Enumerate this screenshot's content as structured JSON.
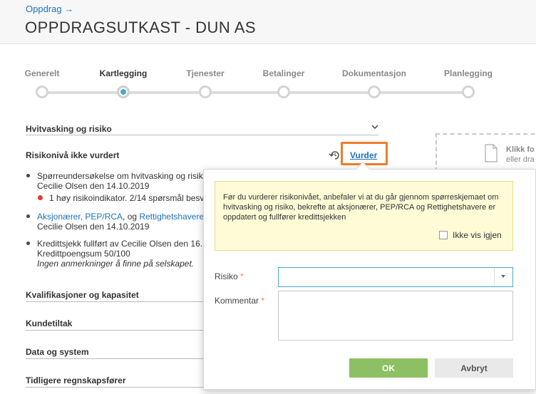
{
  "header": {
    "breadcrumb": "Oppdrag →",
    "title": "OPPDRAGSUTKAST - DUN AS"
  },
  "steps": [
    {
      "label": "Generelt",
      "active": false
    },
    {
      "label": "Kartlegging",
      "active": true
    },
    {
      "label": "Tjenester",
      "active": false
    },
    {
      "label": "Betalinger",
      "active": false
    },
    {
      "label": "Dokumentasjon",
      "active": false
    },
    {
      "label": "Planlegging",
      "active": false
    }
  ],
  "section": {
    "title": "Hvitvasking og risiko",
    "risk_status": "Risikonivå ikke vurdert",
    "assess_link": "Vurder",
    "items": {
      "survey_line1": "Spørreundersøkelse om hvitvasking og risik",
      "survey_line2": "Cecilie Olsen den 14.10.2019",
      "survey_warning": "1 høy risikoindikator. 2/14 spørsmål besv",
      "owners_link1": "Aksjonærer, PEP/RCA",
      "owners_sep": ", og ",
      "owners_link2": "Rettighetshavere",
      "owners_line2": "Cecilie Olsen den 14.10.2019",
      "credit_line1": "Kredittsjekk fullført av Cecilie Olsen den 16.",
      "credit_line2": "Kredittpoengsum 50/100",
      "credit_line3": "Ingen anmerkninger å finne på selskapet."
    }
  },
  "other_sections": [
    "Kvalifikasjoner og kapasitet",
    "Kundetiltak",
    "Data og system",
    "Tidligere regnskapsfører"
  ],
  "dropzone": {
    "line1": "Klikk fo",
    "line2": "eller dra"
  },
  "popup": {
    "warning": "Før du vurderer risikonivået, anbefaler vi at du går gjennom spørreskjemaet om hvitvasking og risiko, bekrefte at aksjonærer, PEP/RCA og Rettighetshavere er oppdatert og fullfører kredittsjekken",
    "dont_show": "Ikke vis igjen",
    "risk_label": "Risiko",
    "comment_label": "Kommentar",
    "required_mark": "*",
    "ok": "OK",
    "cancel": "Avbryt"
  },
  "colors": {
    "accent": "#1a73b8",
    "active_step": "#4aa8c8",
    "highlight": "#f07c2b",
    "ok_button": "#8cc063",
    "warning_bg": "#fffbd6"
  }
}
